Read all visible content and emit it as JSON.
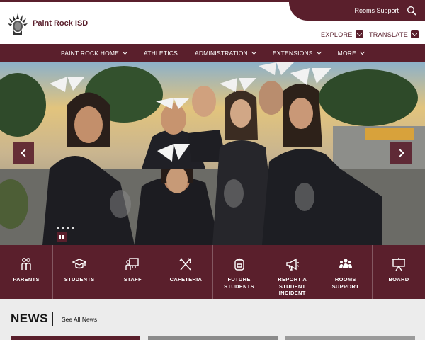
{
  "header": {
    "site_name": "Paint Rock ISD",
    "topbar_link": "Rooms Support",
    "explore_label": "EXPLORE",
    "translate_label": "TRANSLATE"
  },
  "nav": {
    "items": [
      {
        "label": "PAINT ROCK HOME",
        "dropdown": true
      },
      {
        "label": "ATHLETICS",
        "dropdown": false
      },
      {
        "label": "ADMINISTRATION",
        "dropdown": true
      },
      {
        "label": "EXTENSIONS",
        "dropdown": true
      },
      {
        "label": "MORE",
        "dropdown": true
      }
    ]
  },
  "hero": {
    "slide_count": 4,
    "image": "group photo of cheerleaders with white hair bows outdoors at dusk"
  },
  "quick_links": [
    {
      "label": "PARENTS",
      "icon": "parents-icon"
    },
    {
      "label": "STUDENTS",
      "icon": "graduation-cap-icon"
    },
    {
      "label": "STAFF",
      "icon": "staff-board-icon"
    },
    {
      "label": "CAFETERIA",
      "icon": "utensils-icon"
    },
    {
      "label": "FUTURE STUDENTS",
      "icon": "backpack-icon"
    },
    {
      "label": "REPORT A STUDENT INCIDENT",
      "icon": "megaphone-icon"
    },
    {
      "label": "ROOMS SUPPORT",
      "icon": "group-icon"
    },
    {
      "label": "BOARD",
      "icon": "presentation-board-icon"
    }
  ],
  "news": {
    "title": "NEWS",
    "see_all": "See All News"
  },
  "colors": {
    "brand": "#5a1f2c",
    "news_bg": "#ececec"
  }
}
